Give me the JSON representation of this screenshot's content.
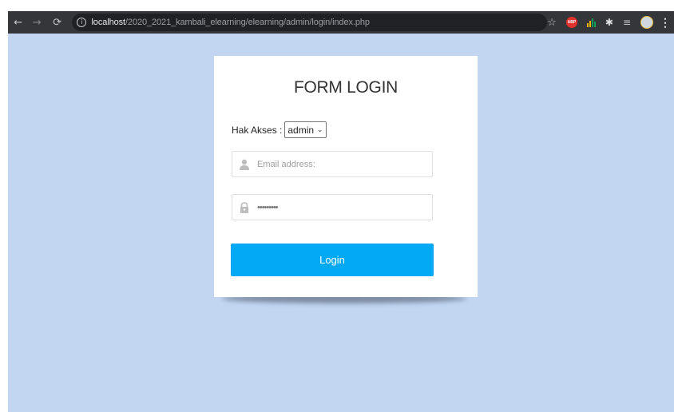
{
  "browser": {
    "back_icon": "arrow-left-icon",
    "forward_icon": "arrow-right-icon",
    "reload_icon": "reload-icon",
    "url_host": "localhost",
    "url_path": "/2020_2021_kambali_elearning/elearning/admin/login/index.php",
    "extensions": [
      "star-icon",
      "adblock-plus-icon",
      "bar-chart-icon",
      "puzzle-icon",
      "media-queue-icon",
      "profile-avatar",
      "menu-icon"
    ],
    "abp_label": "ABP"
  },
  "form": {
    "title": "FORM LOGIN",
    "access_label": "Hak Akses :",
    "access_selected": "admin",
    "email_placeholder": "Email address:",
    "password_mask": "•••••••••",
    "login_label": "Login"
  },
  "colors": {
    "page_background": "#c2d6f2",
    "button": "#03a9f4",
    "card": "#ffffff"
  }
}
